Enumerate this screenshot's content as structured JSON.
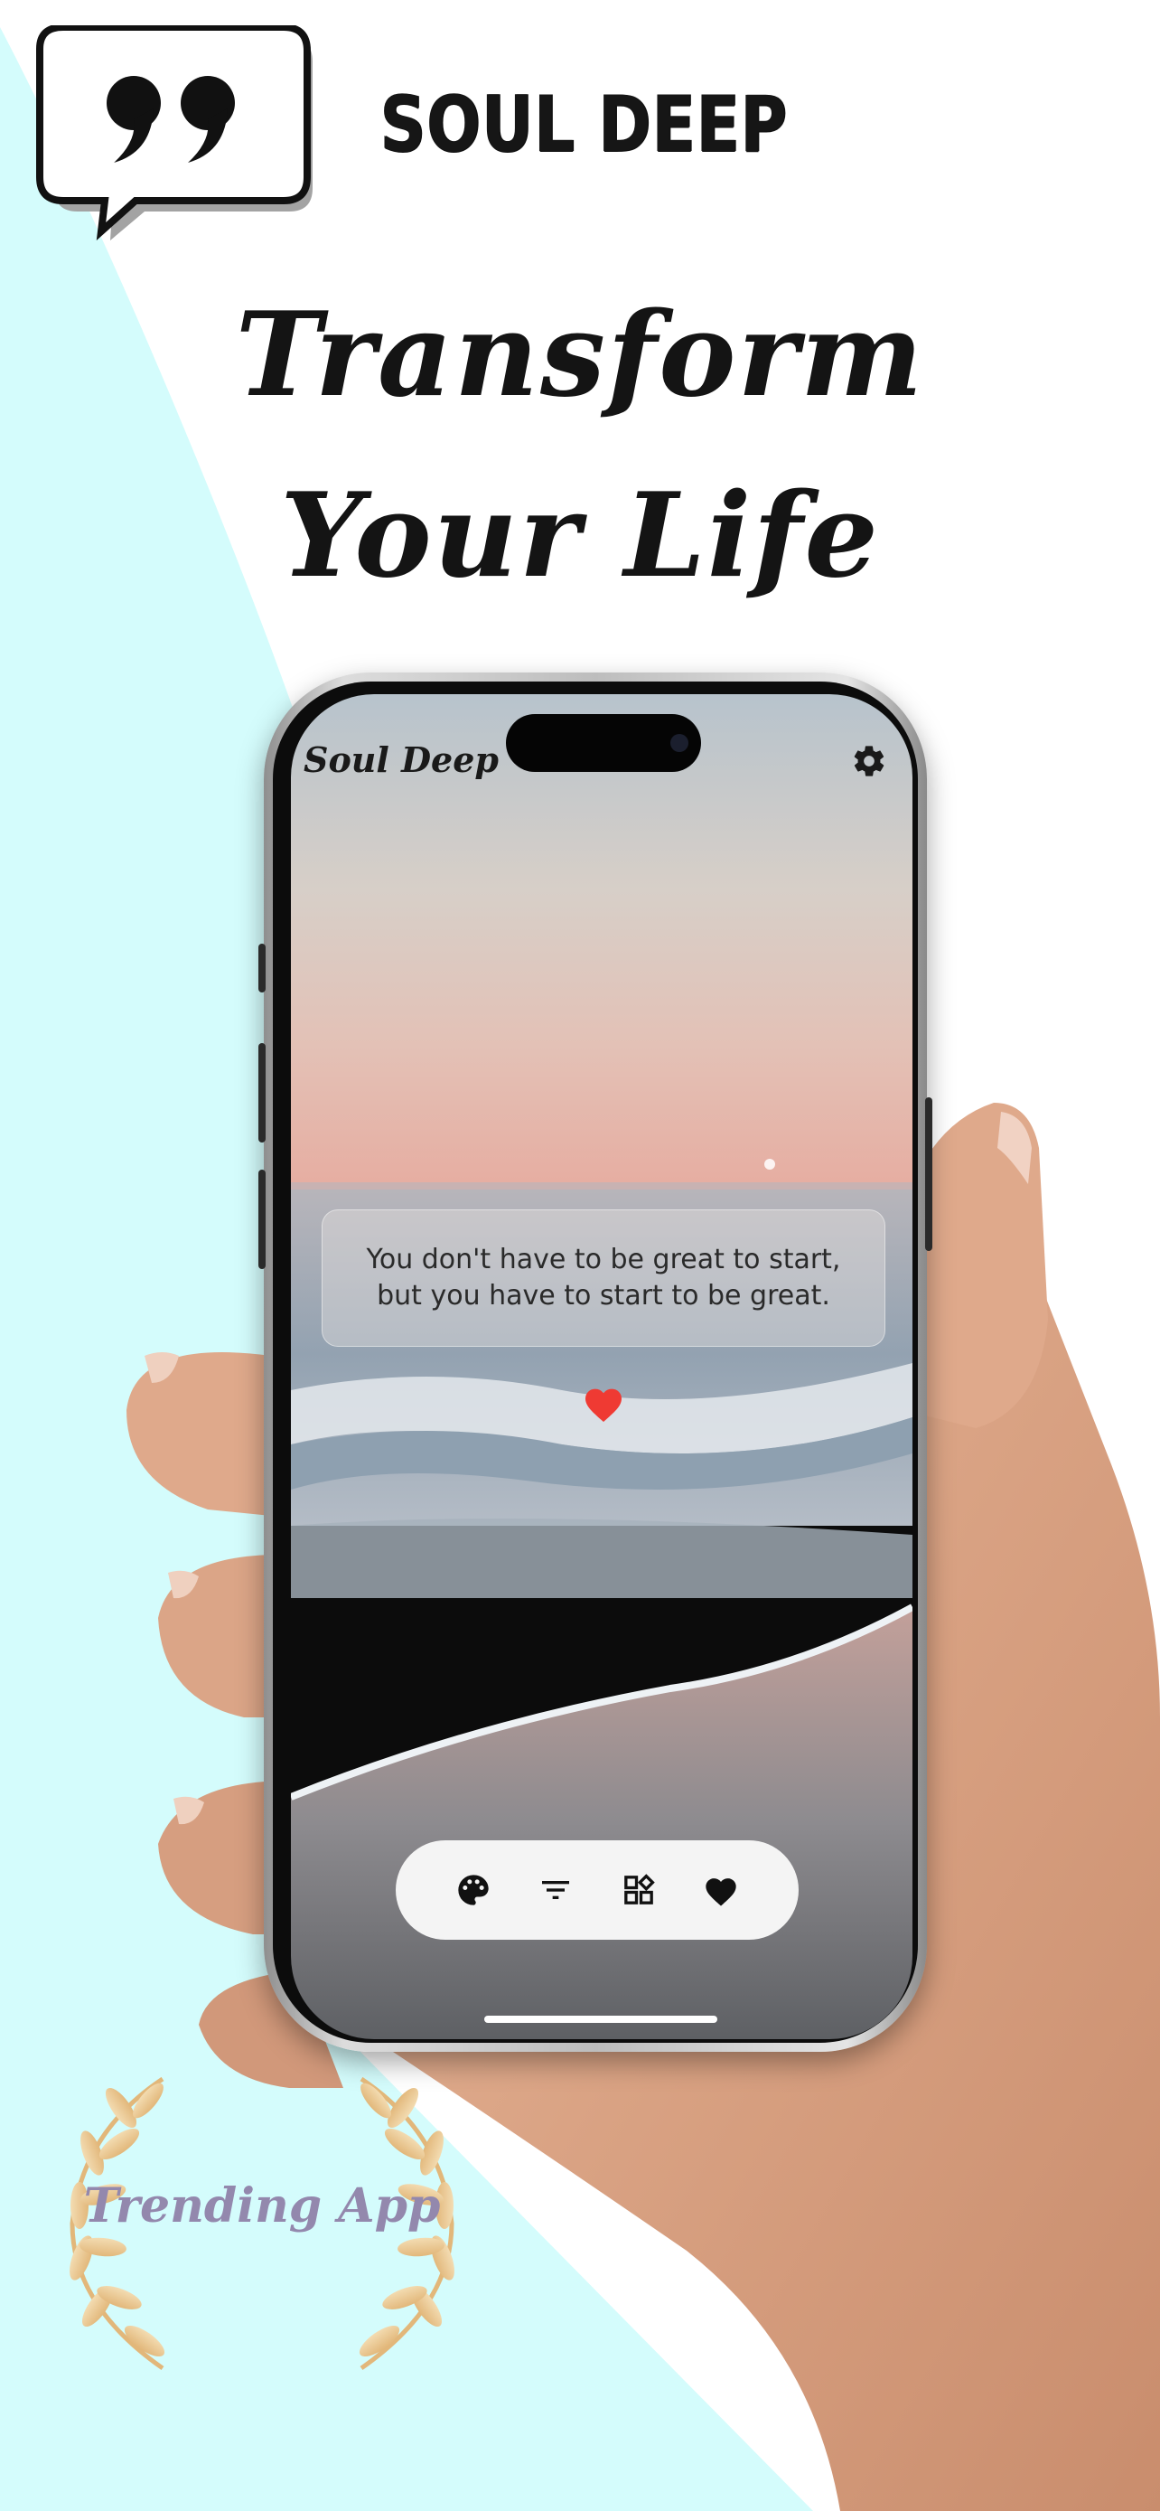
{
  "brand": {
    "name": "SOUL DEEP",
    "logo_icon": "quote-bubble-icon"
  },
  "headline": {
    "line1": "Transform",
    "line2": "Your Life"
  },
  "app": {
    "title": "Soul Deep",
    "settings_icon": "gear-icon",
    "quote": {
      "line1": "You don't have to be great to start,",
      "line2": "but you have to start to be great."
    },
    "like_icon": "heart-icon",
    "toolbar": [
      {
        "name": "palette-icon"
      },
      {
        "name": "filter-icon"
      },
      {
        "name": "categories-icon"
      },
      {
        "name": "favorites-heart-icon"
      }
    ]
  },
  "badge": {
    "text": "Trending App"
  },
  "colors": {
    "background_cyan": "#d4fcfc",
    "like_red": "#ef3a33",
    "badge_text": "#9388ad",
    "laurel_gold": "#e8c48a"
  }
}
